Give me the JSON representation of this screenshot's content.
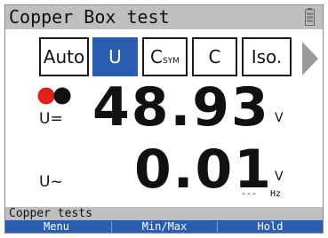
{
  "header": {
    "title": "Copper Box test",
    "battery_icon": "battery-icon"
  },
  "tabs": [
    {
      "label": "Auto",
      "active": false
    },
    {
      "label": "U",
      "active": true
    },
    {
      "label": "C",
      "sub": "SYM",
      "active": false
    },
    {
      "label": "C",
      "active": false
    },
    {
      "label": "Iso.",
      "active": false
    }
  ],
  "next_arrow_icon": "chevron-right-icon",
  "indicators": {
    "dot1_color": "#e0201a",
    "dot2_color": "#111111"
  },
  "readings": {
    "dc": {
      "label": "U=",
      "value": "48.93",
      "unit": "V"
    },
    "ac": {
      "label": "U~",
      "value": "0.01",
      "unit": "V",
      "freq_value": "---",
      "freq_unit": "Hz"
    }
  },
  "status": {
    "text": "Copper tests"
  },
  "softkeys": [
    "Menu",
    "Min/Max",
    "Hold"
  ],
  "colors": {
    "accent": "#2a5db0",
    "bar": "#bfbfbf"
  }
}
